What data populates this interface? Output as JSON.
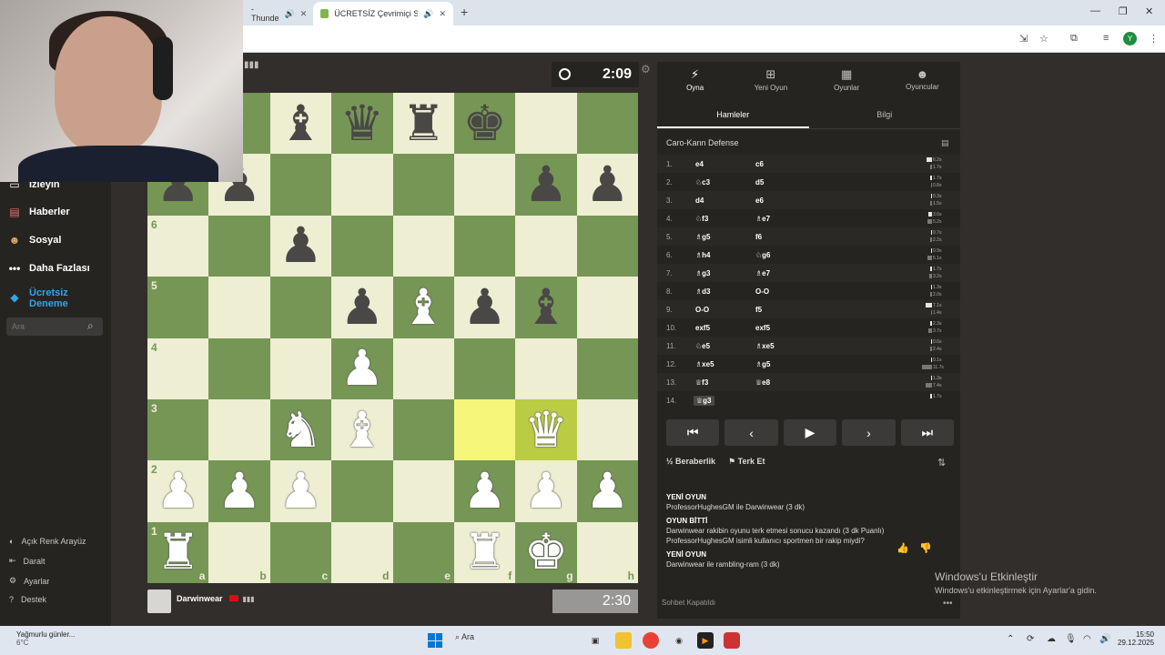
{
  "browser": {
    "tab_inactive": "- Thunde",
    "tab_active": "ÜCRETSİZ Çevrimiçi Satranç",
    "new_tab": "+",
    "profile_initial": "Y"
  },
  "sidebar": {
    "items": [
      {
        "label": "İzleyin",
        "icon": "tv-icon"
      },
      {
        "label": "Haberler",
        "icon": "news-icon"
      },
      {
        "label": "Sosyal",
        "icon": "social-icon"
      },
      {
        "label": "Daha Fazlası",
        "icon": "more-icon"
      },
      {
        "label": "Ücretsiz Deneme",
        "icon": "diamond-icon",
        "color": "#31a6e8"
      }
    ],
    "search_placeholder": "Ara",
    "bottom": [
      {
        "label": "Açık Renk Arayüz",
        "icon": "theme-toggle-icon"
      },
      {
        "label": "Daralt",
        "icon": "collapse-icon"
      },
      {
        "label": "Ayarlar",
        "icon": "gear-icon"
      },
      {
        "label": "Destek",
        "icon": "help-icon"
      }
    ]
  },
  "game": {
    "top_clock": "2:09",
    "bottom_player": "Darwinwear",
    "bottom_clock": "2:30",
    "board": [
      [
        "",
        "",
        "",
        "",
        "",
        "",
        "",
        ""
      ],
      [
        "",
        "",
        "",
        "",
        "",
        "",
        "",
        ""
      ],
      [
        "",
        "",
        "",
        "",
        "",
        "",
        "",
        ""
      ],
      [
        "",
        "",
        "",
        "",
        "",
        "",
        "",
        ""
      ],
      [
        "",
        "",
        "",
        "",
        "",
        "",
        "",
        ""
      ],
      [
        "",
        "",
        "",
        "",
        "",
        "",
        "",
        ""
      ],
      [
        "",
        "",
        "",
        "",
        "",
        "",
        "",
        ""
      ],
      [
        "",
        "",
        "",
        "",
        "",
        "",
        "",
        ""
      ]
    ],
    "pieces": {
      "r8": [
        "b",
        "",
        "B",
        "Q",
        "R",
        "K",
        "",
        ""
      ],
      "r7": [
        "P",
        "P",
        "",
        "",
        "",
        "",
        "P",
        "P"
      ],
      "r6": [
        "",
        "",
        "P",
        "",
        "",
        "",
        "",
        ""
      ],
      "r5": [
        "",
        "",
        "",
        "P",
        "wB",
        "P",
        "B",
        ""
      ],
      "r4": [
        "",
        "",
        "",
        "wP",
        "",
        "",
        "",
        ""
      ],
      "r3": [
        "",
        "",
        "wN",
        "wB",
        "",
        "",
        "wQ",
        ""
      ],
      "r2": [
        "wP",
        "wP",
        "wP",
        "",
        "",
        "wP",
        "wP",
        "wP"
      ],
      "r1": [
        "wR",
        "",
        "",
        "",
        "",
        "wR",
        "wK",
        ""
      ]
    },
    "ranks_visible": [
      "",
      "",
      "6",
      "5",
      "4",
      "3",
      "2",
      "1"
    ],
    "files": [
      "a",
      "b",
      "c",
      "d",
      "e",
      "f",
      "g",
      "h"
    ]
  },
  "panel": {
    "tabs": [
      {
        "label": "Oyna",
        "icon": "play-icon"
      },
      {
        "label": "Yeni Oyun",
        "icon": "new-game-icon"
      },
      {
        "label": "Oyunlar",
        "icon": "games-icon"
      },
      {
        "label": "Oyuncular",
        "icon": "players-icon"
      }
    ],
    "subtabs": [
      "Hamleler",
      "Bilgi"
    ],
    "opening": "Caro-Kann Defense",
    "moves": [
      {
        "n": "1.",
        "w": "e4",
        "b": "c6",
        "tw": "6.2s",
        "tb": "1.7s",
        "ww": 6,
        "wb": 2
      },
      {
        "n": "2.",
        "w": "♘c3",
        "b": "d5",
        "tw": "1.7s",
        "tb": "0.8s",
        "ww": 2,
        "wb": 1
      },
      {
        "n": "3.",
        "w": "d4",
        "b": "e6",
        "tw": "0.3s",
        "tb": "1.5s",
        "ww": 1,
        "wb": 2
      },
      {
        "n": "4.",
        "w": "♘f3",
        "b": "♗e7",
        "tw": "3.6s",
        "tb": "5.2s",
        "ww": 4,
        "wb": 5
      },
      {
        "n": "5.",
        "w": "♗g5",
        "b": "f6",
        "tw": "0.7s",
        "tb": "2.2s",
        "ww": 1,
        "wb": 2
      },
      {
        "n": "6.",
        "w": "♗h4",
        "b": "♘g6",
        "tw": "0.9s",
        "tb": "5.1s",
        "ww": 1,
        "wb": 5
      },
      {
        "n": "7.",
        "w": "♗g3",
        "b": "♗e7",
        "tw": "1.7s",
        "tb": "3.2s",
        "ww": 2,
        "wb": 3
      },
      {
        "n": "8.",
        "w": "♗d3",
        "b": "O-O",
        "tw": "1.3s",
        "tb": "2.0s",
        "ww": 1,
        "wb": 2
      },
      {
        "n": "9.",
        "w": "O-O",
        "b": "f5",
        "tw": "7.1s",
        "tb": "1.4s",
        "ww": 7,
        "wb": 1
      },
      {
        "n": "10.",
        "w": "exf5",
        "b": "exf5",
        "tw": "2.3s",
        "tb": "3.7s",
        "ww": 2,
        "wb": 4
      },
      {
        "n": "11.",
        "w": "♘e5",
        "b": "♗xe5",
        "tw": "0.6s",
        "tb": "2.4s",
        "ww": 1,
        "wb": 2
      },
      {
        "n": "12.",
        "w": "♗xe5",
        "b": "♗g5",
        "tw": "0.1s",
        "tb": "11.7s",
        "ww": 1,
        "wb": 11
      },
      {
        "n": "13.",
        "w": "♕f3",
        "b": "♕e8",
        "tw": "1.3s",
        "tb": "7.4s",
        "ww": 1,
        "wb": 7
      },
      {
        "n": "14.",
        "w": "♕g3",
        "b": "",
        "tw": "1.7s",
        "tb": "",
        "ww": 2,
        "wb": 0
      }
    ],
    "nav": [
      "⏮",
      "‹",
      "▶",
      "›",
      "⏭"
    ],
    "draw": "Beraberlik",
    "resign": "Terk Et",
    "chat": [
      {
        "type": "head",
        "text": "YENİ OYUN"
      },
      {
        "type": "line",
        "text": "ProfessorHughesGM ile Darwinwear (3 dk)"
      },
      {
        "type": "head",
        "text": "OYUN BİTTİ"
      },
      {
        "type": "line",
        "text": "Darwinwear rakibin oyunu terk etmesi sonucu kazandı (3 dk Puanlı)"
      },
      {
        "type": "line",
        "text": "ProfessorHughesGM isimli kullanıcı sportmen bir rakip miydi?"
      },
      {
        "type": "head",
        "text": "YENİ OYUN"
      },
      {
        "type": "line",
        "text": "Darwinwear ile rambling-ram (3 dk)"
      }
    ],
    "chat_footer": "Sohbet Kapatıldı"
  },
  "watermark": {
    "title": "Windows'u Etkinleştir",
    "sub": "Windows'u etkinleştirmek için Ayarlar'a gidin."
  },
  "taskbar": {
    "weather_title": "Yağmurlu günler...",
    "weather_temp": "6°C",
    "search": "Ara",
    "time": "15:50",
    "date": "29.12.2025"
  }
}
